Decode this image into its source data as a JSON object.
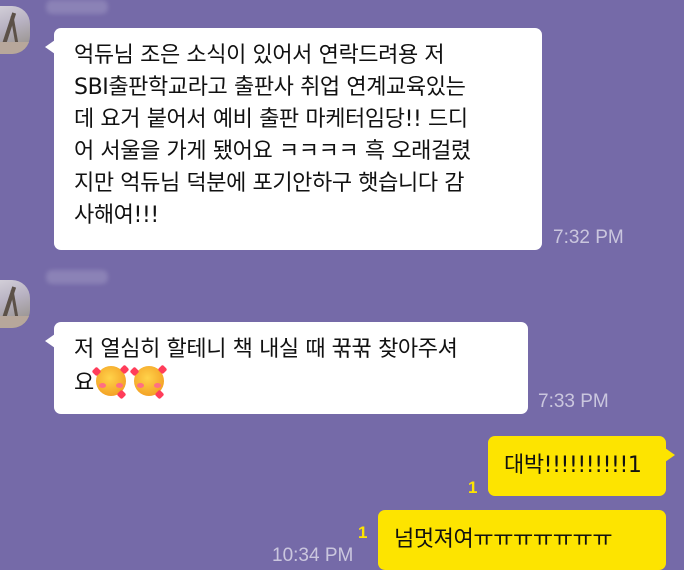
{
  "conversation": {
    "messages": [
      {
        "sender": "other",
        "lines": [
          "억듀님 조은 소식이 있어서 연락드려용 저",
          "SBI출판학교라고 출판사 취업 연계교육있는",
          "데 요거 붙어서 예비 출판 마케터임당!! 드디",
          "어 서울을 가게 됐어요 ㅋㅋㅋㅋ 흑 오래걸렸",
          "지만 억듀님 덕분에 포기안하구 햇습니다 감",
          "사해여!!!"
        ],
        "time": "7:32 PM"
      },
      {
        "sender": "other",
        "lines": [
          "저 열심히 할테니 책 내실 때 꾺꾺 찾아주셔",
          "요"
        ],
        "emoji": "smiling-face-with-hearts",
        "time": "7:33 PM"
      },
      {
        "sender": "me",
        "text": "대박!!!!!!!!!!1",
        "unread": "1"
      },
      {
        "sender": "me",
        "text": "넘멋져여ㅠㅠㅠㅠㅠㅠㅠ",
        "unread": "1",
        "time": "10:34 PM"
      }
    ]
  },
  "colors": {
    "background": "#756aa8",
    "incoming_bubble": "#ffffff",
    "outgoing_bubble": "#fde400",
    "unread_count": "#fde400"
  }
}
